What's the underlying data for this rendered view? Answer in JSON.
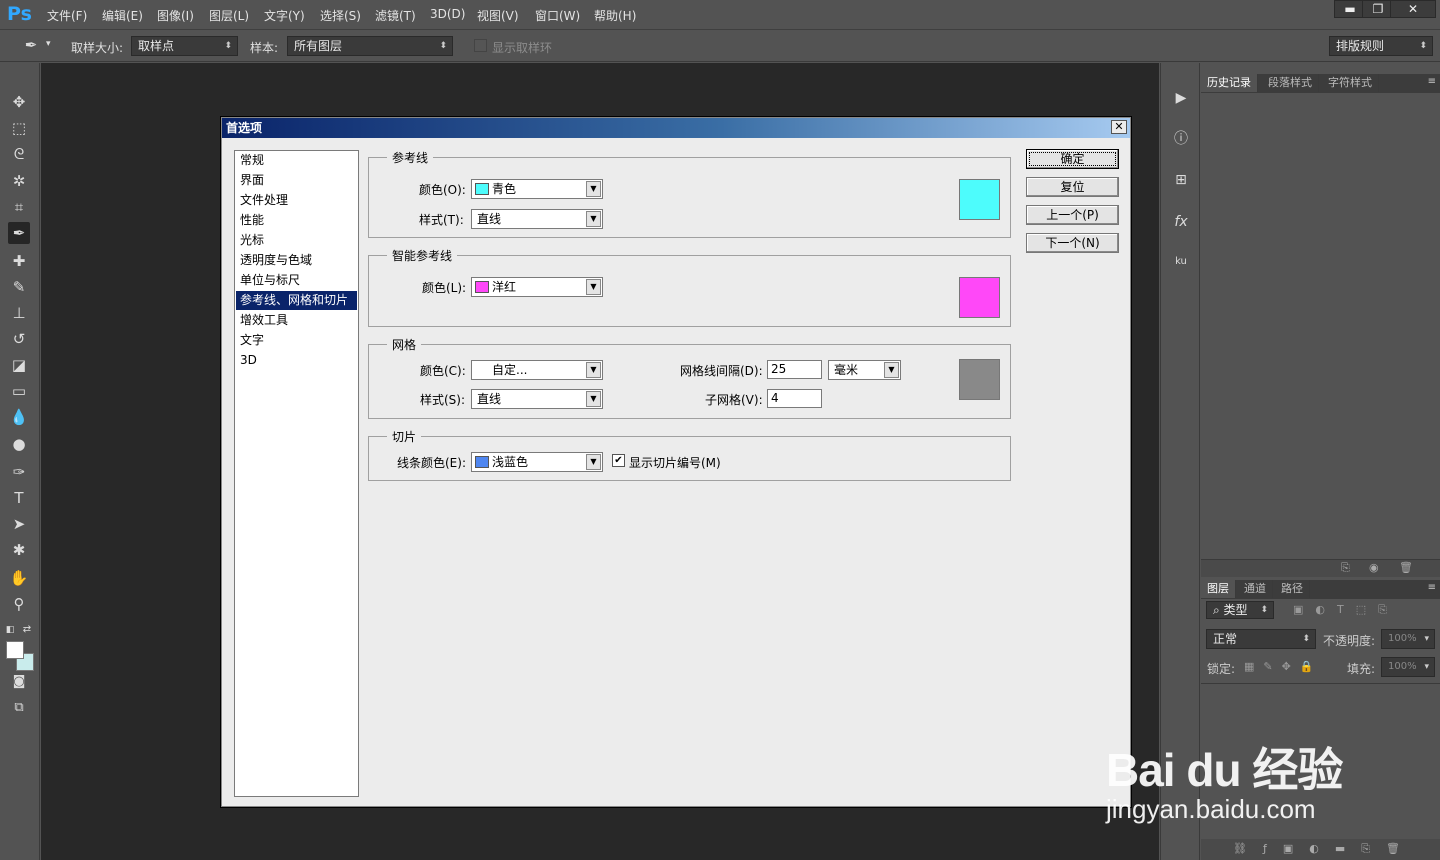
{
  "app": {
    "logo": "Ps"
  },
  "menubar": {
    "items": [
      "文件(F)",
      "编辑(E)",
      "图像(I)",
      "图层(L)",
      "文字(Y)",
      "选择(S)",
      "滤镜(T)",
      "3D(D)",
      "视图(V)",
      "窗口(W)",
      "帮助(H)"
    ],
    "window_buttons": {
      "minimize": "▬",
      "restore": "❐",
      "close": "✕"
    }
  },
  "options": {
    "sample_size_label": "取样大小:",
    "sample_size_value": "取样点",
    "sample_label": "样本:",
    "sample_value": "所有图层",
    "show_ring_label": "显示取样环",
    "workspace_value": "排版规则"
  },
  "panels": {
    "top_tabs": [
      "历史记录",
      "段落样式",
      "字符样式"
    ],
    "bottom_tabs": [
      "图层",
      "通道",
      "路径"
    ],
    "filter_label": "类型",
    "blend_mode": "正常",
    "opacity_label": "不透明度:",
    "opacity_value": "100%",
    "lock_label": "锁定:",
    "fill_label": "填充:",
    "fill_value": "100%"
  },
  "dialog": {
    "title": "首选项",
    "close_glyph": "✕",
    "categories": [
      "常规",
      "界面",
      "文件处理",
      "性能",
      "光标",
      "透明度与色域",
      "单位与标尺",
      "参考线、网格和切片",
      "增效工具",
      "文字",
      "3D"
    ],
    "selected_category": "参考线、网格和切片",
    "guides": {
      "title": "参考线",
      "color_label": "颜色(O):",
      "color_value": "青色",
      "color_hex": "#4dfcfc",
      "style_label": "样式(T):",
      "style_value": "直线"
    },
    "smart_guides": {
      "title": "智能参考线",
      "color_label": "颜色(L):",
      "color_value": "洋红",
      "color_hex": "#ff48f8"
    },
    "grid": {
      "title": "网格",
      "color_label": "颜色(C):",
      "color_value": "自定...",
      "color_hex": "#898989",
      "style_label": "样式(S):",
      "style_value": "直线",
      "spacing_label": "网格线间隔(D):",
      "spacing_value": "25",
      "unit_value": "毫米",
      "subdivisions_label": "子网格(V):",
      "subdivisions_value": "4"
    },
    "slices": {
      "title": "切片",
      "line_color_label": "线条颜色(E):",
      "line_color_value": "浅蓝色",
      "line_color_hex": "#4f86f0",
      "show_numbers_label": "显示切片编号(M)",
      "show_numbers_checked": true
    },
    "buttons": {
      "ok": "确定",
      "reset": "复位",
      "prev": "上一个(P)",
      "next": "下一个(N)"
    }
  },
  "watermark": {
    "logo": "Bai du 经验",
    "url": "jingyan.baidu.com"
  }
}
